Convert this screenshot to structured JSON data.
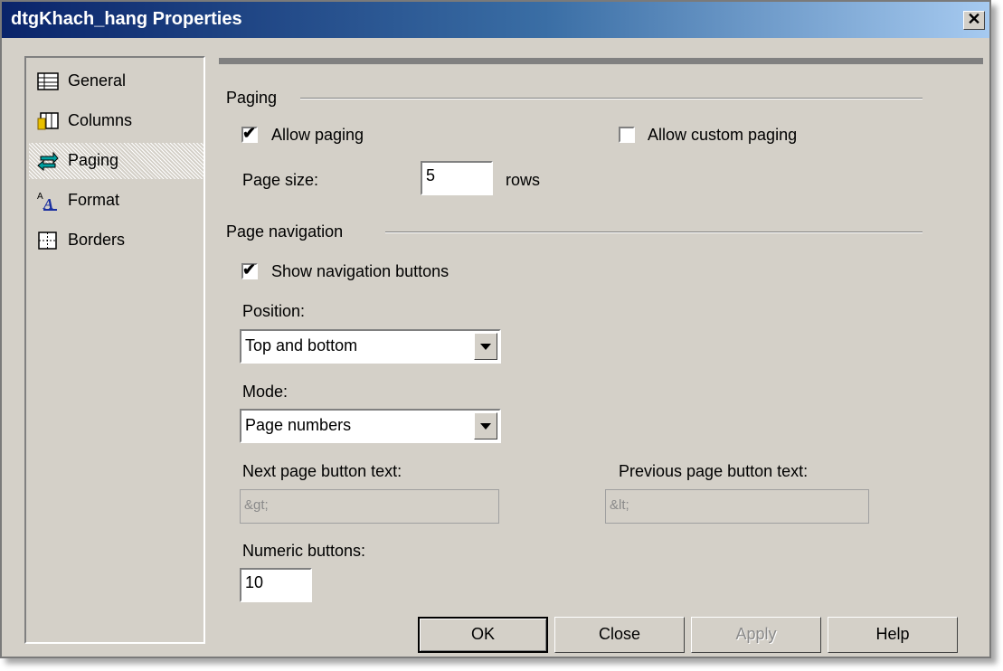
{
  "window": {
    "title": "dtgKhach_hang Properties",
    "close_glyph": "✕"
  },
  "sidebar": {
    "items": [
      {
        "label": "General",
        "icon": "general-icon"
      },
      {
        "label": "Columns",
        "icon": "columns-icon"
      },
      {
        "label": "Paging",
        "icon": "paging-icon",
        "selected": true
      },
      {
        "label": "Format",
        "icon": "format-icon"
      },
      {
        "label": "Borders",
        "icon": "borders-icon"
      }
    ]
  },
  "paging": {
    "section_label": "Paging",
    "allow_paging": {
      "label": "Allow paging",
      "checked": true
    },
    "allow_custom_paging": {
      "label": "Allow custom paging",
      "checked": false
    },
    "page_size_label": "Page size:",
    "page_size_value": "5",
    "page_size_unit": "rows"
  },
  "navigation": {
    "section_label": "Page navigation",
    "show_buttons": {
      "label": "Show navigation buttons",
      "checked": true
    },
    "position_label": "Position:",
    "position_value": "Top and bottom",
    "mode_label": "Mode:",
    "mode_value": "Page numbers",
    "next_text_label": "Next page button text:",
    "next_text_value": "&gt;",
    "prev_text_label": "Previous page button text:",
    "prev_text_value": "&lt;",
    "numeric_label": "Numeric buttons:",
    "numeric_value": "10"
  },
  "buttons": {
    "ok": "OK",
    "close": "Close",
    "apply": "Apply",
    "help": "Help"
  },
  "colors": {
    "title_start": "#0a246a",
    "title_end": "#a6caf0",
    "face": "#d4d0c8"
  }
}
